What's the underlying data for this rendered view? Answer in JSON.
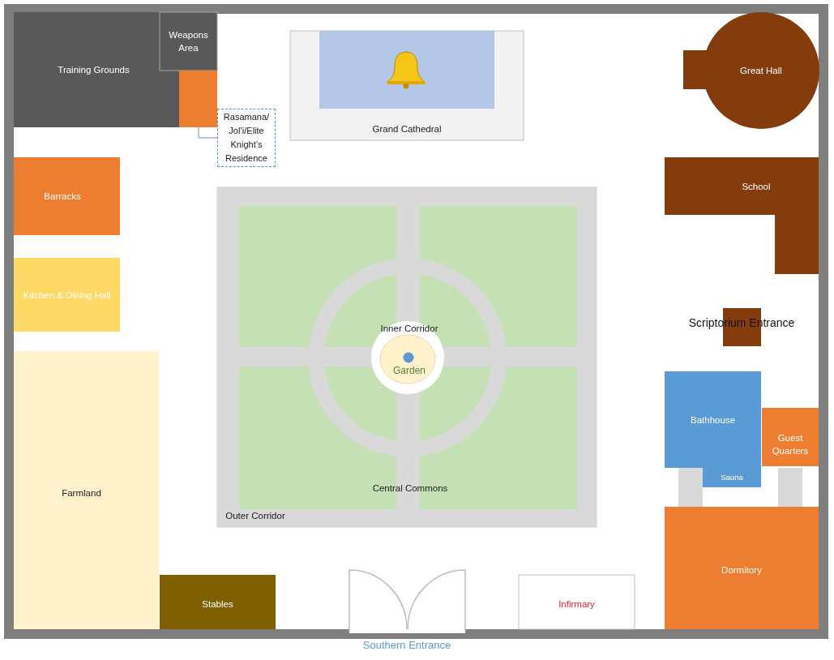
{
  "plan": {
    "areas": [
      {
        "label": "Training Grounds",
        "color": "#595959"
      },
      {
        "label": "Weapons Area",
        "color": "#595959"
      },
      {
        "label": "Rasamana/ Jol’i/Elite Knight’s Residence",
        "color": "#ed7d31"
      },
      {
        "label": "Grand Cathedral",
        "color": "#f2f2f2"
      },
      {
        "label": "Great Hall",
        "color": "#843c0c"
      },
      {
        "label": "Barracks",
        "color": "#ed7d31"
      },
      {
        "label": "School",
        "color": "#843c0c"
      },
      {
        "label": "Kitchen & Dining Hall",
        "color": "#ffd966"
      },
      {
        "label": "Scriptorium Entrance",
        "color": "#843c0c"
      },
      {
        "label": "Farmland",
        "color": "#fff2cc"
      },
      {
        "label": "Bathhouse",
        "color": "#5b9bd5"
      },
      {
        "label": "Sauna",
        "color": "#5b9bd5"
      },
      {
        "label": "Guest Quarters",
        "color": "#ed7d31"
      },
      {
        "label": "Dormitory",
        "color": "#ed7d31"
      },
      {
        "label": "Stables",
        "color": "#7f6000"
      },
      {
        "label": "Infirmary"
      }
    ],
    "courtyard": {
      "inner_corridor": "Inner Corridor",
      "garden": "Garden",
      "central_commons": "Central Commons",
      "outer_corridor": "Outer Corridor"
    },
    "entrance": {
      "label": "Southern Entrance"
    }
  }
}
